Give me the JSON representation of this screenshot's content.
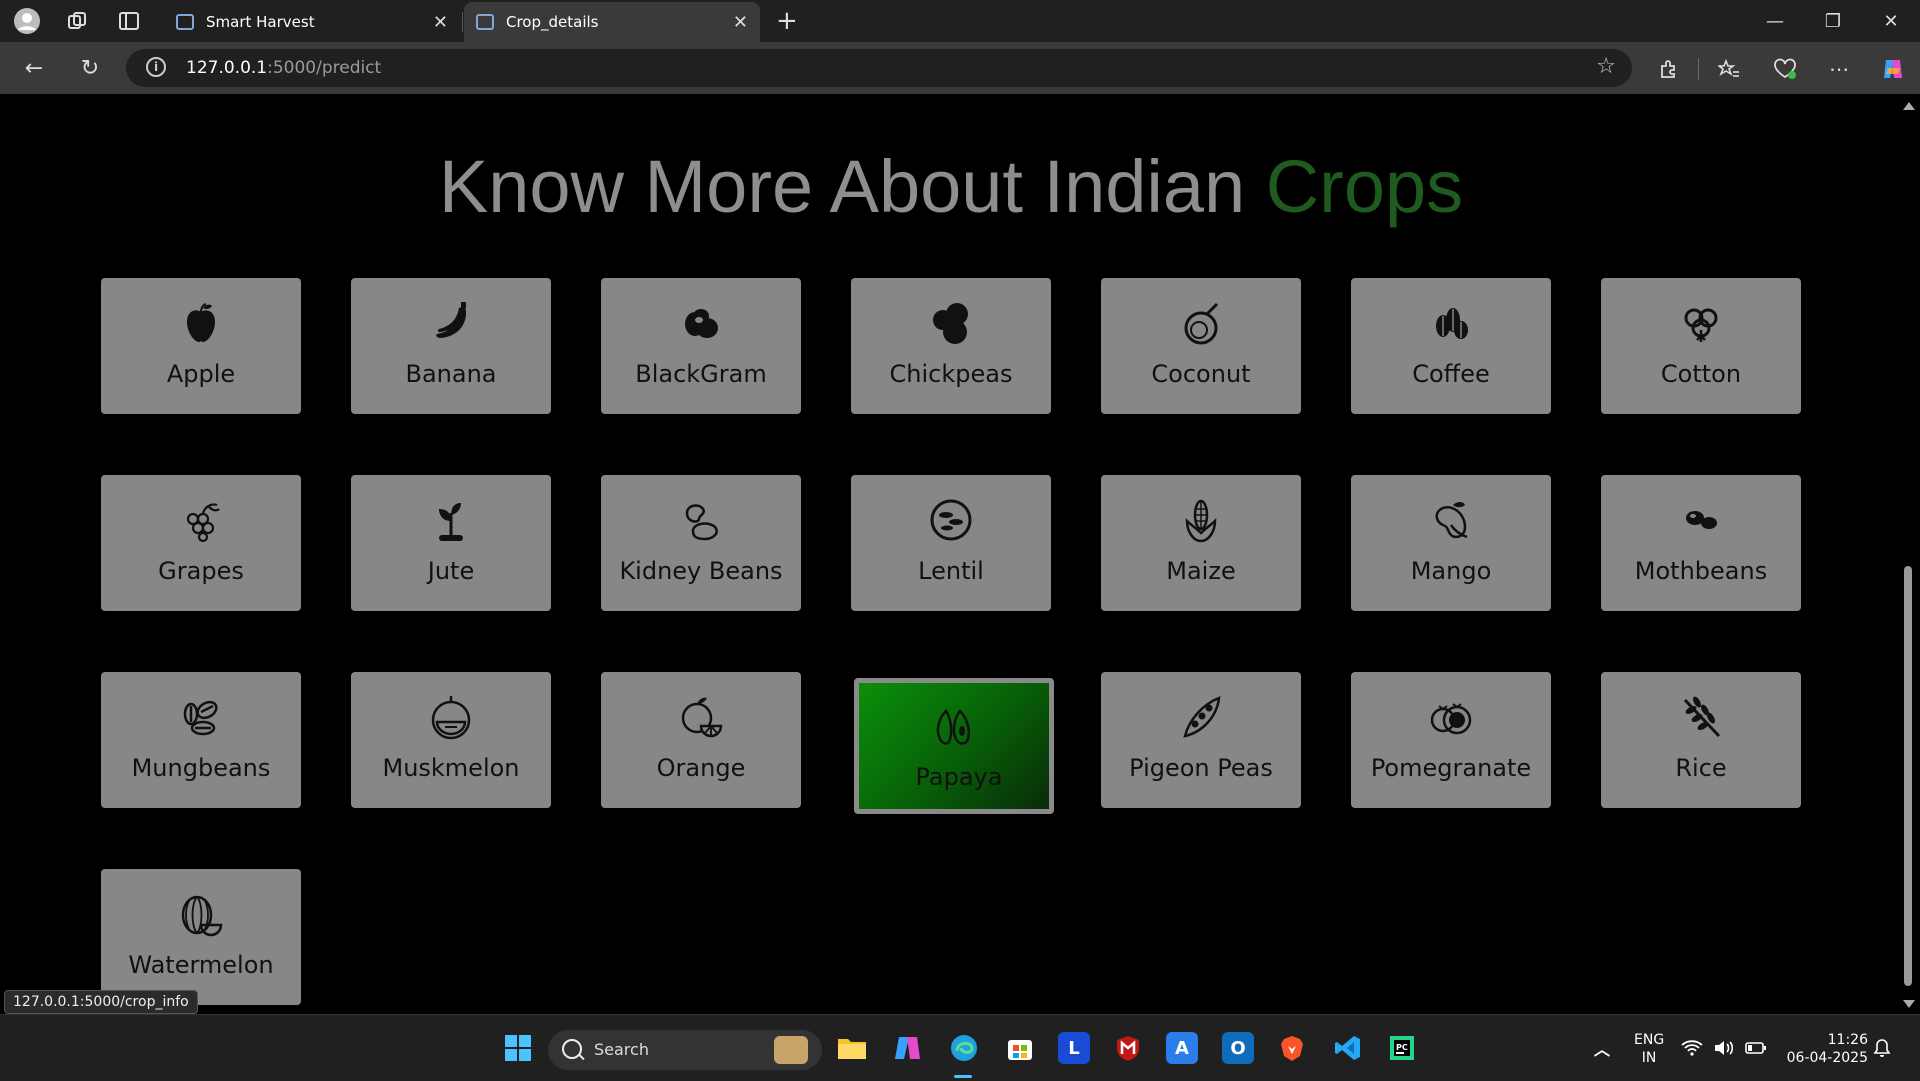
{
  "browser": {
    "tabs": [
      {
        "title": "Smart Harvest",
        "active": false
      },
      {
        "title": "Crop_details",
        "active": true
      }
    ],
    "url_host": "127.0.0.1",
    "url_path": ":5000/predict",
    "status_url": "127.0.0.1:5000/crop_info"
  },
  "page": {
    "title_main": "Know More About Indian ",
    "title_accent": "Crops",
    "crops": [
      {
        "label": "Apple",
        "icon": "apple-icon"
      },
      {
        "label": "Banana",
        "icon": "banana-icon"
      },
      {
        "label": "BlackGram",
        "icon": "blackgram-icon"
      },
      {
        "label": "Chickpeas",
        "icon": "chickpeas-icon"
      },
      {
        "label": "Coconut",
        "icon": "coconut-icon"
      },
      {
        "label": "Coffee",
        "icon": "coffee-icon"
      },
      {
        "label": "Cotton",
        "icon": "cotton-icon"
      },
      {
        "label": "Grapes",
        "icon": "grapes-icon"
      },
      {
        "label": "Jute",
        "icon": "sprout-icon"
      },
      {
        "label": "Kidney Beans",
        "icon": "kidney-beans-icon"
      },
      {
        "label": "Lentil",
        "icon": "lentil-icon"
      },
      {
        "label": "Maize",
        "icon": "maize-icon"
      },
      {
        "label": "Mango",
        "icon": "mango-icon"
      },
      {
        "label": "Mothbeans",
        "icon": "mothbeans-icon"
      },
      {
        "label": "Mungbeans",
        "icon": "mungbeans-icon"
      },
      {
        "label": "Muskmelon",
        "icon": "muskmelon-icon"
      },
      {
        "label": "Orange",
        "icon": "orange-icon"
      },
      {
        "label": "Papaya",
        "icon": "papaya-icon",
        "hovered": true
      },
      {
        "label": "Pigeon Peas",
        "icon": "pea-pod-icon"
      },
      {
        "label": "Pomegranate",
        "icon": "pomegranate-icon"
      },
      {
        "label": "Rice",
        "icon": "rice-icon"
      },
      {
        "label": "Watermelon",
        "icon": "watermelon-icon"
      }
    ]
  },
  "taskbar": {
    "search_label": "Search",
    "lang_line1": "ENG",
    "lang_line2": "IN",
    "time": "11:26",
    "date": "06-04-2025"
  },
  "colors": {
    "title_gray": "#8e8e8e",
    "title_accent": "#1f5a1f",
    "card_bg": "#878787",
    "active_green": "#0b8f0b"
  }
}
